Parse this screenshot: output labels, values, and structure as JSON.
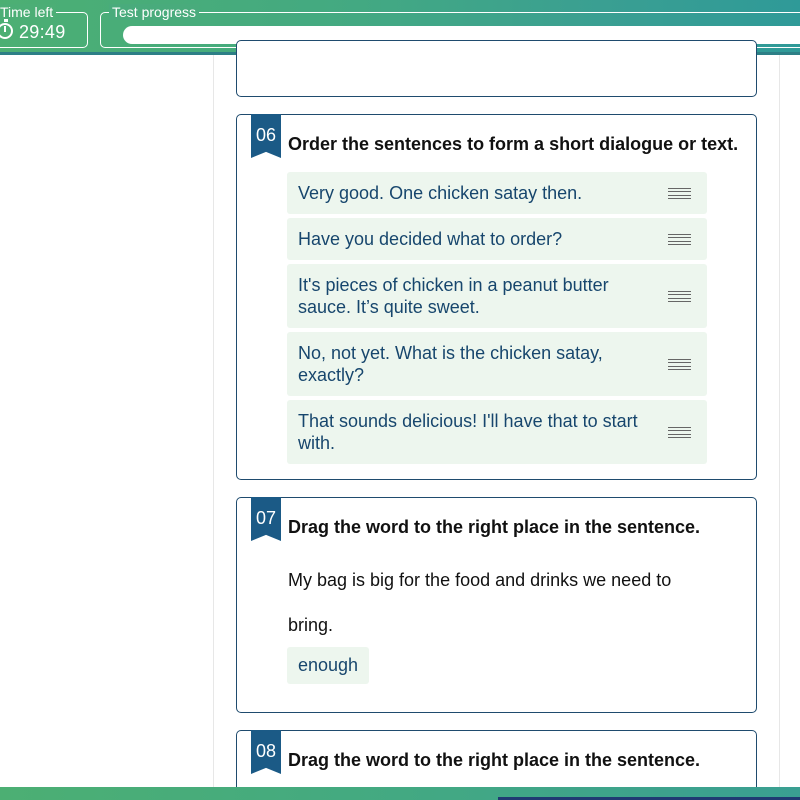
{
  "header": {
    "time_left_label": "Time left",
    "time_left_value": "29:49",
    "progress_label": "Test progress"
  },
  "questions": [
    {
      "number": "06",
      "title": "Order the sentences to form a short dialogue or text.",
      "items": [
        "Very good. One chicken satay then.",
        "Have you decided what to order?",
        "It's pieces of chicken in a peanut butter sauce. It’s quite sweet.",
        "No, not yet. What is the chicken satay, exactly?",
        "That sounds delicious! I'll have that to start with."
      ]
    },
    {
      "number": "07",
      "title": "Drag the word to the right place in the sentence.",
      "sentence_line1": "My bag is big for the food and drinks we need to",
      "sentence_line2": "bring.",
      "word": "enough"
    },
    {
      "number": "08",
      "title": "Drag the word to the right place in the sentence."
    }
  ],
  "colors": {
    "header_green": "#4caf73",
    "header_teal": "#2f9a98",
    "number_badge": "#1b5a86",
    "item_bg": "#edf6ee",
    "item_text": "#17466d",
    "card_border": "#1f4b6e"
  }
}
